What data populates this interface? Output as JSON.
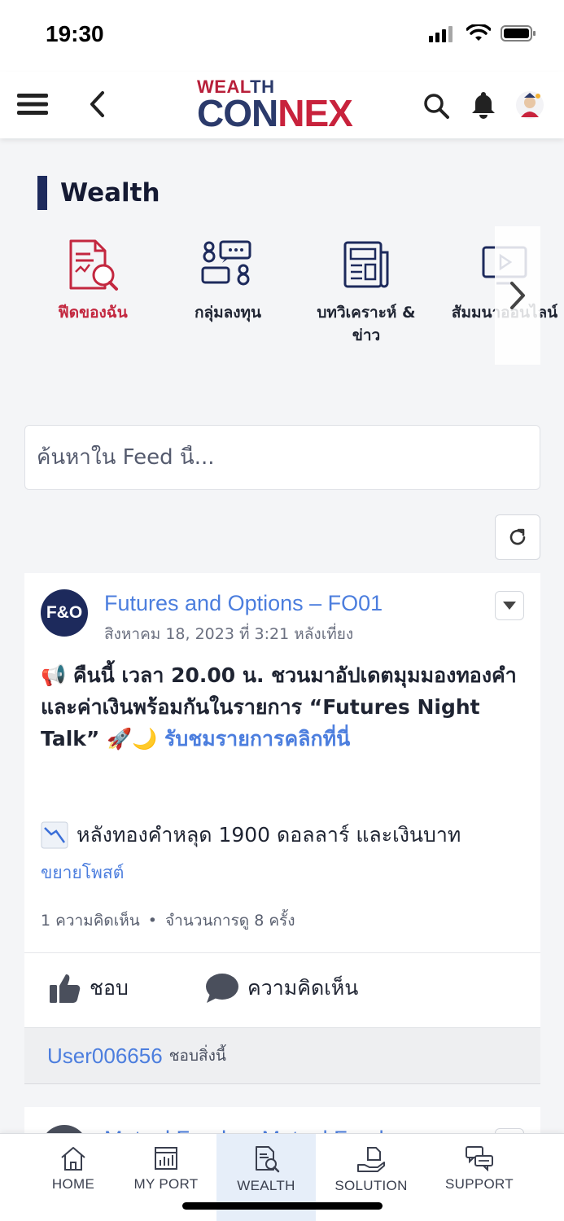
{
  "status_bar": {
    "time": "19:30"
  },
  "header": {
    "logo_top_1": "WEAL",
    "logo_top_2": "TH",
    "logo_bottom_1": "CON",
    "logo_bottom_2": "NEX",
    "icons": [
      "menu-icon",
      "back-icon",
      "search-icon",
      "bell-icon",
      "profile-icon"
    ]
  },
  "section": {
    "title": "Wealth"
  },
  "categories": [
    {
      "label": "ฟีดของฉัน",
      "icon": "my-feed-icon",
      "active": true
    },
    {
      "label": "กลุ่มลงทุน",
      "icon": "investment-group-icon",
      "active": false
    },
    {
      "label": "บทวิเคราะห์ & ข่าว",
      "icon": "news-analysis-icon",
      "active": false
    },
    {
      "label": "สัมมนาออนไลน์",
      "icon": "webinar-icon",
      "active": false
    }
  ],
  "search": {
    "placeholder": "ค้นหาใน Feed นี้..."
  },
  "post": {
    "avatar_text": "F&O",
    "author": "Futures and Options – FO01",
    "date": "สิงหาคม 18, 2023 ที่ 3:21 หลังเที่ยง",
    "body_main": "📢 คืนนี้ เวลา 20.00 น. ชวนมาอัปเดตมุมมองทองคำและค่าเงินพร้อมกันในรายการ “Futures Night Talk” 🚀🌙 ",
    "body_link": "รับชมรายการคลิกที่นี่",
    "body_second": "หลังทองคำหลุด 1900 ดอลลาร์ และเงินบาท",
    "expand_label": "ขยายโพสต์",
    "comments_count": "1 ความคิดเห็น",
    "separator": "•",
    "views": "จำนวนการดู 8 ครั้ง",
    "like_label": "ชอบ",
    "comment_label": "ความคิดเห็น",
    "liked_by_user": "User006656",
    "liked_by_text": "ชอบสิ่งนี้"
  },
  "next_post": {
    "author": "Mutual Funds – Mutual Fund"
  },
  "bottom_nav": [
    {
      "label": "HOME",
      "icon": "home-icon",
      "active": false
    },
    {
      "label": "MY PORT",
      "icon": "portfolio-icon",
      "active": false
    },
    {
      "label": "WEALTH",
      "icon": "wealth-icon",
      "active": true
    },
    {
      "label": "SOLUTION",
      "icon": "solution-icon",
      "active": false
    },
    {
      "label": "SUPPORT",
      "icon": "support-icon",
      "active": false
    }
  ],
  "colors": {
    "accent_red": "#c3273f",
    "brand_navy": "#1d2a5c",
    "link_blue": "#4c7ede"
  }
}
